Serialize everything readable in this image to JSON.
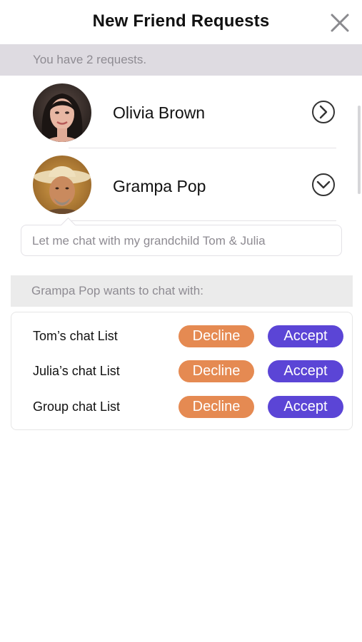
{
  "header": {
    "title": "New Friend Requests"
  },
  "info_bar": {
    "text": "You have 2 requests."
  },
  "requests": [
    {
      "name": "Olivia Brown",
      "expanded": false
    },
    {
      "name": "Grampa Pop",
      "expanded": true
    }
  ],
  "message": {
    "text": "Let me chat with my grandchild Tom & Julia"
  },
  "wants_chat": {
    "text": "Grampa Pop wants to chat with:"
  },
  "chat_lists": [
    {
      "label": "Tom’s chat List",
      "decline_label": "Decline",
      "accept_label": "Accept"
    },
    {
      "label": "Julia’s chat List",
      "decline_label": "Decline",
      "accept_label": "Accept"
    },
    {
      "label": "Group chat List",
      "decline_label": "Decline",
      "accept_label": "Accept"
    }
  ],
  "icons": {
    "close": "close-icon",
    "collapsed": "chevron-right-circle-icon",
    "expanded": "chevron-down-circle-icon"
  },
  "colors": {
    "decline": "#e58a52",
    "accept": "#5b45d6",
    "info_bar_bg": "#dedbe1"
  }
}
